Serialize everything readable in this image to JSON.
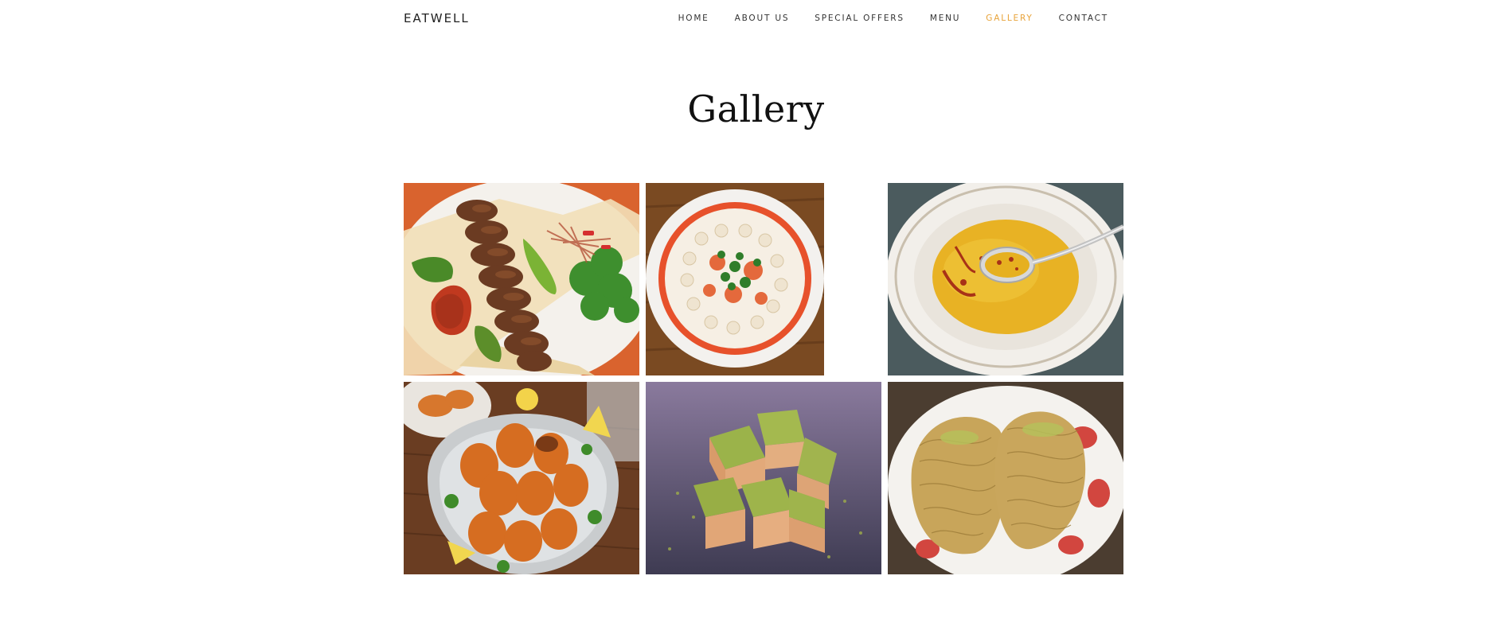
{
  "site": {
    "brand": "EATWELL"
  },
  "nav": {
    "items": [
      {
        "label": "HOME"
      },
      {
        "label": "ABOUT US"
      },
      {
        "label": "SPECIAL OFFERS"
      },
      {
        "label": "MENU"
      },
      {
        "label": "GALLERY",
        "active": true
      },
      {
        "label": "CONTACT"
      }
    ],
    "active_color": "#e8a339"
  },
  "gallery": {
    "title": "Gallery",
    "images": [
      {
        "subject": "adana kebab plate"
      },
      {
        "subject": "manti dumplings bowl"
      },
      {
        "subject": "lentil soup with spoon"
      },
      {
        "subject": "icli kofte platter"
      },
      {
        "subject": "pistachio baklava"
      },
      {
        "subject": "kadayif dessert plate"
      }
    ]
  }
}
